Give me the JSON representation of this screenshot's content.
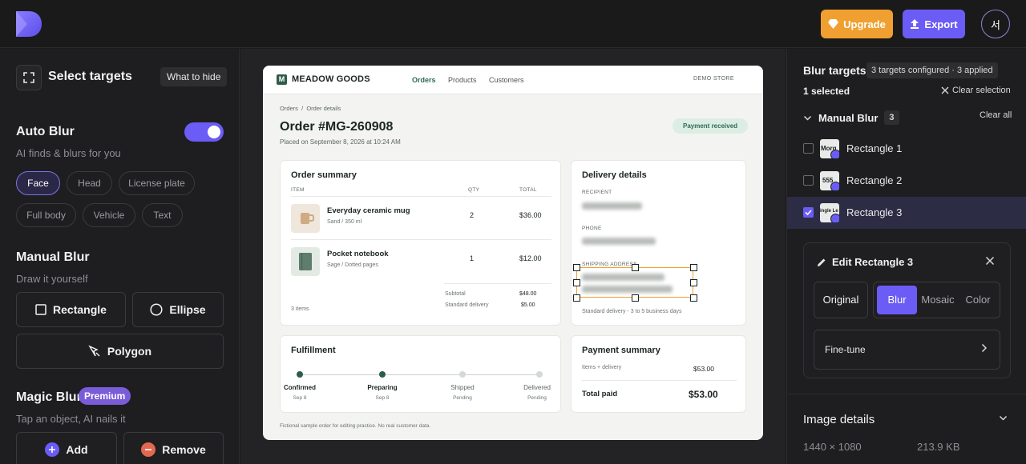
{
  "header": {
    "upgrade_label": "Upgrade",
    "export_label": "Export",
    "avatar_initial": "서"
  },
  "left": {
    "select_title": "Select targets",
    "what_to_hide": "What to hide",
    "auto_blur": {
      "title": "Auto Blur",
      "subtitle": "AI finds & blurs for you",
      "enabled": true
    },
    "chips": [
      "Face",
      "Head",
      "License plate",
      "Full body",
      "Vehicle",
      "Text"
    ],
    "active_chip": "Face",
    "manual_blur": {
      "title": "Manual Blur",
      "subtitle": "Draw it yourself",
      "rectangle": "Rectangle",
      "ellipse": "Ellipse",
      "polygon": "Polygon"
    },
    "magic_blur": {
      "title": "Magic Blur",
      "badge": "Premium",
      "subtitle": "Tap an object, AI nails it",
      "add": "Add",
      "remove": "Remove"
    }
  },
  "canvas": {
    "brand": "MEADOW GOODS",
    "brand_initial": "M",
    "nav": [
      "Orders",
      "Products",
      "Customers"
    ],
    "demo_label": "DEMO STORE",
    "breadcrumb": "Orders  /  Order details",
    "order_title": "Order #MG-260908",
    "placed": "Placed on September 8, 2026 at 10:24 AM",
    "status": "Payment received",
    "summary": {
      "title": "Order summary",
      "headers": {
        "item": "ITEM",
        "qty": "QTY",
        "total": "TOTAL"
      },
      "items": [
        {
          "name": "Everyday ceramic mug",
          "variant": "Sand / 350 ml",
          "qty": "2",
          "total": "$36.00"
        },
        {
          "name": "Pocket notebook",
          "variant": "Sage / Dotted pages",
          "qty": "1",
          "total": "$12.00"
        }
      ],
      "item_count": "3 items",
      "subtotal_label": "Subtotal",
      "subtotal": "$48.00",
      "delivery_label": "Standard delivery",
      "delivery": "$5.00"
    },
    "delivery": {
      "title": "Delivery details",
      "recipient_label": "RECIPIENT",
      "phone_label": "PHONE",
      "address_label": "SHIPPING ADDRESS",
      "note": "Standard delivery - 3 to 5 business days"
    },
    "fulfillment": {
      "title": "Fulfillment",
      "steps": [
        {
          "label": "Confirmed",
          "date": "Sep 8"
        },
        {
          "label": "Preparing",
          "date": "Sep 8"
        },
        {
          "label": "Shipped",
          "date": "Pending"
        },
        {
          "label": "Delivered",
          "date": "Pending"
        }
      ]
    },
    "payment": {
      "title": "Payment summary",
      "items_label": "Items + delivery",
      "items_value": "$53.00",
      "total_label": "Total paid",
      "total_value": "$53.00"
    },
    "footnote": "Fictional sample order for editing practice. No real customer data."
  },
  "right": {
    "title": "Blur targets",
    "badge": "3 targets configured · 3 applied",
    "selected": "1 selected",
    "clear_selection": "Clear selection",
    "manual_blur": "Manual Blur",
    "manual_count": "3",
    "clear_all": "Clear all",
    "targets": [
      {
        "label": "Rectangle 1",
        "checked": false,
        "thumb_text": "Morg"
      },
      {
        "label": "Rectangle 2",
        "checked": false,
        "thumb_text": "555"
      },
      {
        "label": "Rectangle 3",
        "checked": true,
        "thumb_text": "ingle Le"
      }
    ],
    "edit": {
      "title": "Edit Rectangle 3",
      "original": "Original",
      "options": [
        "Blur",
        "Mosaic",
        "Color"
      ],
      "active_option": "Blur",
      "fine_tune": "Fine-tune"
    },
    "image_details": {
      "title": "Image details",
      "dimensions": "1440 × 1080",
      "size": "213.9 KB"
    }
  },
  "colors": {
    "accent": "#6b5cf5",
    "upgrade": "#f0a030",
    "selection": "#f0a030",
    "brand_green": "#2f5c4a"
  }
}
